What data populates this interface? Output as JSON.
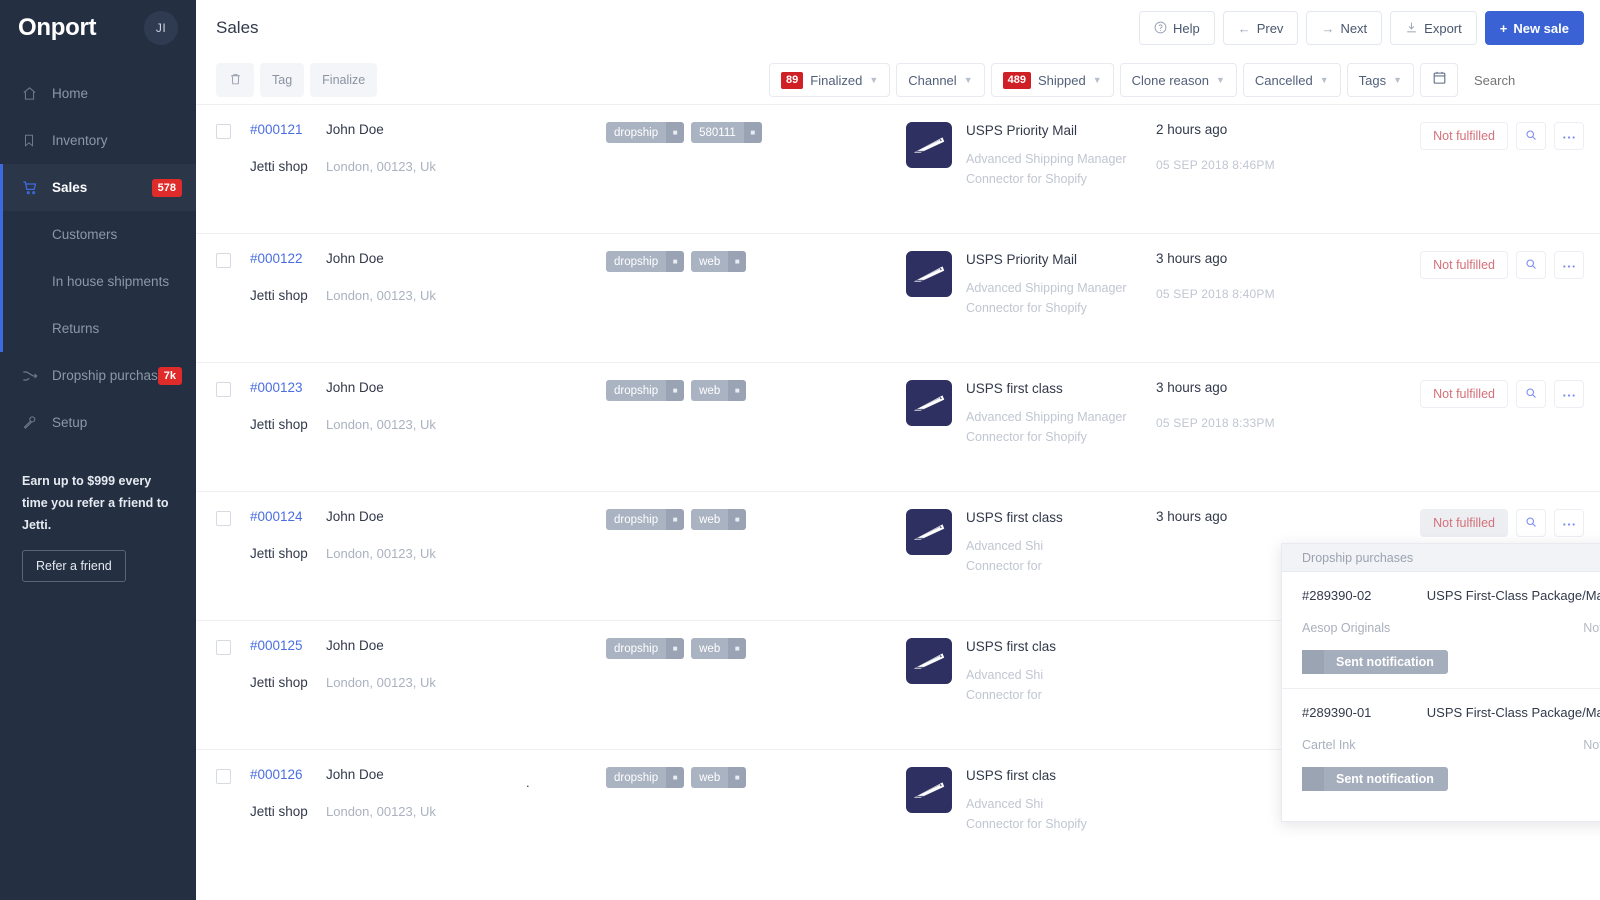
{
  "sidebar": {
    "brand": "Onport",
    "avatar_initials": "JI",
    "items": [
      {
        "label": "Home",
        "icon": "home-icon",
        "badge": "",
        "active": false,
        "sub": false
      },
      {
        "label": "Inventory",
        "icon": "bookmark-icon",
        "badge": "",
        "active": false,
        "sub": false
      },
      {
        "label": "Sales",
        "icon": "cart-icon",
        "badge": "578",
        "active": true,
        "sub": false
      },
      {
        "label": "Customers",
        "icon": "",
        "badge": "",
        "active": false,
        "sub": true
      },
      {
        "label": "In house shipments",
        "icon": "",
        "badge": "",
        "active": false,
        "sub": true
      },
      {
        "label": "Returns",
        "icon": "",
        "badge": "",
        "active": false,
        "sub": true
      },
      {
        "label": "Dropship purchases",
        "icon": "shuffle-icon",
        "badge": "7k",
        "active": false,
        "sub": false
      },
      {
        "label": "Setup",
        "icon": "wrench-icon",
        "badge": "",
        "active": false,
        "sub": false
      }
    ],
    "promo": {
      "text": "Earn up to $999 every time you refer a friend to Jetti.",
      "button": "Refer a friend"
    }
  },
  "header": {
    "title": "Sales",
    "actions": [
      {
        "label": "Help",
        "glyph": "?",
        "icon": "help-icon",
        "primary": false
      },
      {
        "label": "Prev",
        "glyph": "←",
        "icon": "arrow-left-icon",
        "primary": false
      },
      {
        "label": "Next",
        "glyph": "→",
        "icon": "arrow-right-icon",
        "primary": false
      },
      {
        "label": "Export",
        "glyph": "↧",
        "icon": "download-icon",
        "primary": false
      },
      {
        "label": "New sale",
        "glyph": "+",
        "icon": "plus-icon",
        "primary": true
      }
    ]
  },
  "filterbar": {
    "bulk": [
      {
        "label": "",
        "icon": "trash-icon"
      },
      {
        "label": "Tag",
        "icon": ""
      },
      {
        "label": "Finalize",
        "icon": ""
      }
    ],
    "filters": [
      {
        "label": "Finalized",
        "count": "89"
      },
      {
        "label": "Channel",
        "count": ""
      },
      {
        "label": "Shipped",
        "count": "489"
      },
      {
        "label": "Clone reason",
        "count": ""
      },
      {
        "label": "Cancelled",
        "count": ""
      },
      {
        "label": "Tags",
        "count": ""
      }
    ],
    "calendar_icon": "calendar-icon",
    "search_placeholder": "Search",
    "search_value": ""
  },
  "rows": [
    {
      "order": "#000121",
      "shop": "Jetti shop",
      "customer": "John Doe",
      "address": "London, 00123, Uk",
      "tags": [
        {
          "label": "dropship"
        },
        {
          "label": "580111"
        }
      ],
      "carrier": "USPS Priority Mail",
      "carrier_sub1": "Advanced Shipping Manager",
      "carrier_sub2": "Connector for Shopify",
      "ago": "2 hours ago",
      "stamp": "05 SEP 2018 8:46PM",
      "status": "Not fulfilled",
      "status_hover": false,
      "dot": false
    },
    {
      "order": "#000122",
      "shop": "Jetti shop",
      "customer": "John Doe",
      "address": "London, 00123, Uk",
      "tags": [
        {
          "label": "dropship"
        },
        {
          "label": "web"
        }
      ],
      "carrier": "USPS Priority Mail",
      "carrier_sub1": "Advanced Shipping Manager",
      "carrier_sub2": "Connector for Shopify",
      "ago": "3 hours ago",
      "stamp": "05 SEP 2018 8:40PM",
      "status": "Not fulfilled",
      "status_hover": false,
      "dot": false
    },
    {
      "order": "#000123",
      "shop": "Jetti shop",
      "customer": "John Doe",
      "address": "London, 00123, Uk",
      "tags": [
        {
          "label": "dropship"
        },
        {
          "label": "web"
        }
      ],
      "carrier": "USPS first class",
      "carrier_sub1": "Advanced Shipping Manager",
      "carrier_sub2": "Connector for Shopify",
      "ago": "3 hours ago",
      "stamp": "05 SEP 2018 8:33PM",
      "status": "Not fulfilled",
      "status_hover": false,
      "dot": false
    },
    {
      "order": "#000124",
      "shop": "Jetti shop",
      "customer": "John Doe",
      "address": "London, 00123, Uk",
      "tags": [
        {
          "label": "dropship"
        },
        {
          "label": "web"
        }
      ],
      "carrier": "USPS first class",
      "carrier_sub1": "Advanced Shi",
      "carrier_sub2": "Connector for",
      "ago": "3 hours ago",
      "stamp": "",
      "status": "Not fulfilled",
      "status_hover": true,
      "dot": false
    },
    {
      "order": "#000125",
      "shop": "Jetti shop",
      "customer": "John Doe",
      "address": "London, 00123, Uk",
      "tags": [
        {
          "label": "dropship"
        },
        {
          "label": "web"
        }
      ],
      "carrier": "USPS first clas",
      "carrier_sub1": "Advanced Shi",
      "carrier_sub2": "Connector for",
      "ago": "",
      "stamp": "",
      "status": "",
      "status_hover": false,
      "dot": false
    },
    {
      "order": "#000126",
      "shop": "Jetti shop",
      "customer": "John Doe",
      "address": "London, 00123, Uk",
      "tags": [
        {
          "label": "dropship"
        },
        {
          "label": "web"
        }
      ],
      "carrier": "USPS first clas",
      "carrier_sub1": "Advanced Shi",
      "carrier_sub2": "Connector for Shopify",
      "ago": "",
      "stamp": "",
      "status": "",
      "status_hover": false,
      "dot": true
    }
  ],
  "popup": {
    "title": "Dropship purchases",
    "entries": [
      {
        "id": "#289390-02",
        "service": "USPS First-Class Package/Mail Parcel",
        "vendor": "Aesop Originals",
        "shipped": "Not shipped",
        "button": "Sent notification"
      },
      {
        "id": "#289390-01",
        "service": "USPS First-Class Package/Mail Parcel",
        "vendor": "Cartel Ink",
        "shipped": "Not shipped",
        "button": "Sent notification"
      }
    ]
  },
  "colors": {
    "sidebar_bg": "#242f41",
    "accent_blue": "#3a62d4",
    "badge_red": "#e02b2b",
    "filter_count_red": "#cf2026",
    "link_blue": "#4a6ee0",
    "status_red": "#d4707a",
    "usps_navy": "#2e3061"
  }
}
